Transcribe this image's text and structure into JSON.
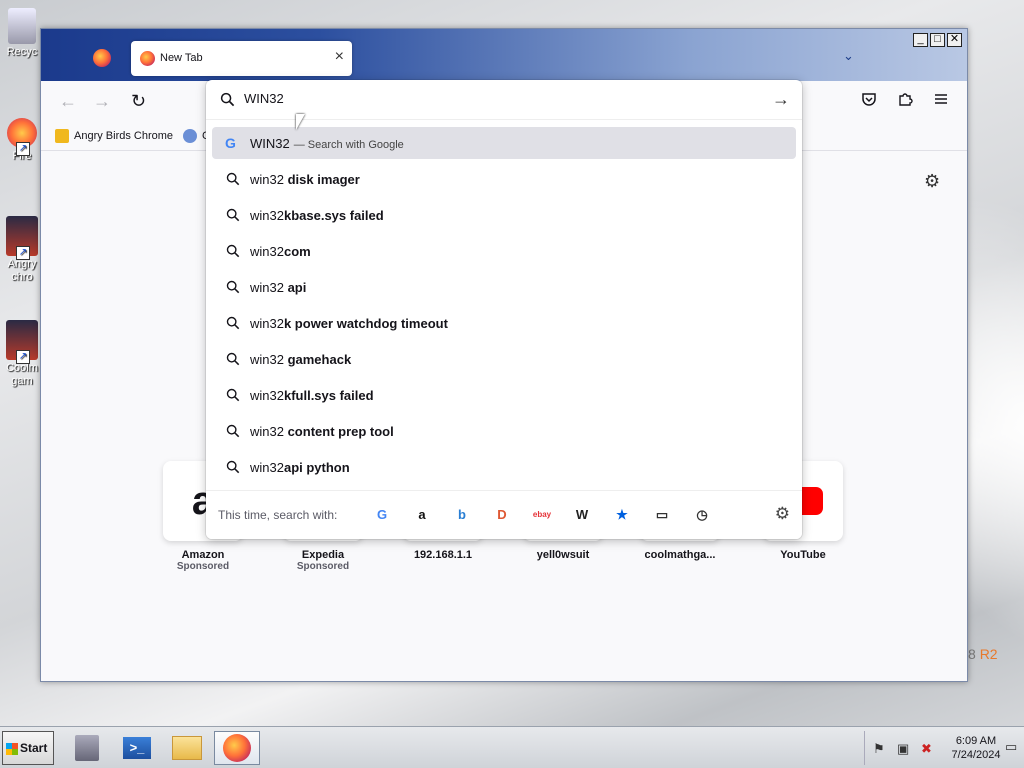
{
  "desktop": {
    "icons": [
      {
        "label": "Recyc",
        "name": "recycle-bin"
      },
      {
        "label": "Fire",
        "name": "firefox-shortcut"
      },
      {
        "label": "Angry chro",
        "name": "angry-birds-shortcut"
      },
      {
        "label": "Coolm gam",
        "name": "coolmath-shortcut"
      }
    ],
    "watermark": "8",
    "watermark_r2": "R2"
  },
  "window": {
    "controls": {
      "minimize": "_",
      "maximize": "□",
      "close": "✕"
    }
  },
  "tabs": [
    {
      "title": "New Tab",
      "close": "×"
    }
  ],
  "toolbar": {
    "back": "←",
    "forward": "→",
    "reload": "↻"
  },
  "bookmarks": [
    {
      "label": "Angry Birds Chrome"
    },
    {
      "label": "C"
    }
  ],
  "urlbar": {
    "value": "WIN32",
    "go": "→"
  },
  "suggestions": [
    {
      "typed": "WIN32",
      "rest": "",
      "hint": "— Search with Google",
      "engine": "G",
      "selected": true
    },
    {
      "typed": "win32",
      "rest": " disk imager"
    },
    {
      "typed": "win32",
      "rest": "kbase.sys failed"
    },
    {
      "typed": "win32",
      "rest": "com"
    },
    {
      "typed": "win32",
      "rest": " api"
    },
    {
      "typed": "win32",
      "rest": "k power watchdog timeout"
    },
    {
      "typed": "win32",
      "rest": " gamehack"
    },
    {
      "typed": "win32",
      "rest": "kfull.sys failed"
    },
    {
      "typed": "win32",
      "rest": " content prep tool"
    },
    {
      "typed": "win32",
      "rest": "api python"
    }
  ],
  "one_off_search": {
    "label": "This time, search with:",
    "engines": [
      {
        "name": "google",
        "glyph": "G",
        "color": "#4285f4"
      },
      {
        "name": "amazon",
        "glyph": "a",
        "color": "#111111"
      },
      {
        "name": "bing",
        "glyph": "b",
        "color": "#2a7fd4"
      },
      {
        "name": "duckduckgo",
        "glyph": "D",
        "color": "#de5833"
      },
      {
        "name": "ebay",
        "glyph": "ebay",
        "color": "#e53238"
      },
      {
        "name": "wikipedia",
        "glyph": "W",
        "color": "#222222"
      },
      {
        "name": "bookmarks",
        "glyph": "★",
        "color": "#0060df"
      },
      {
        "name": "tabs",
        "glyph": "▭",
        "color": "#333333"
      },
      {
        "name": "history",
        "glyph": "◷",
        "color": "#333333"
      }
    ]
  },
  "top_sites": [
    {
      "name": "Amazon",
      "sponsored": "Sponsored",
      "glyph": "a"
    },
    {
      "name": "Expedia",
      "sponsored": "Sponsored",
      "glyph": ""
    },
    {
      "name": "192.168.1.1",
      "sponsored": "",
      "glyph": ""
    },
    {
      "name": "yell0wsuit",
      "sponsored": "",
      "glyph": ""
    },
    {
      "name": "coolmathga...",
      "sponsored": "",
      "glyph": ""
    },
    {
      "name": "YouTube",
      "sponsored": "",
      "glyph": ""
    }
  ],
  "taskbar": {
    "start": "Start",
    "clock_time": "6:09 AM",
    "clock_date": "7/24/2024"
  }
}
